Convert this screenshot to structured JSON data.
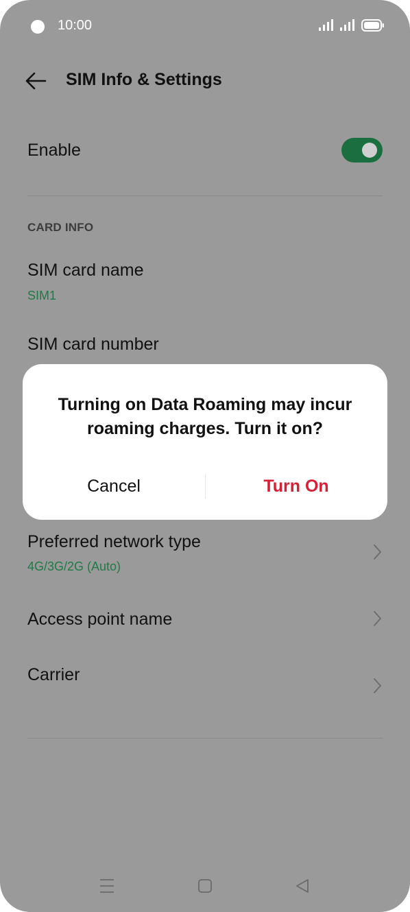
{
  "status_bar": {
    "time": "10:00"
  },
  "header": {
    "title": "SIM Info & Settings",
    "back_icon": "arrow-left-icon"
  },
  "settings": {
    "enable_label": "Enable",
    "enable_on": true,
    "section_card_info": "CARD INFO",
    "sim_name_label": "SIM card name",
    "sim_name_value": "SIM1",
    "sim_number_label": "SIM card number",
    "preferred_network_label": "Preferred network type",
    "preferred_network_value": "4G/3G/2G (Auto)",
    "apn_label": "Access point name",
    "carrier_label": "Carrier"
  },
  "dialog": {
    "message": "Turning on Data Roaming may incur roaming charges. Turn it on?",
    "cancel_label": "Cancel",
    "confirm_label": "Turn On"
  },
  "colors": {
    "scrim_background": "#9a9a9a",
    "accent_green": "#1b6e40",
    "confirm_red": "#d81f38"
  }
}
